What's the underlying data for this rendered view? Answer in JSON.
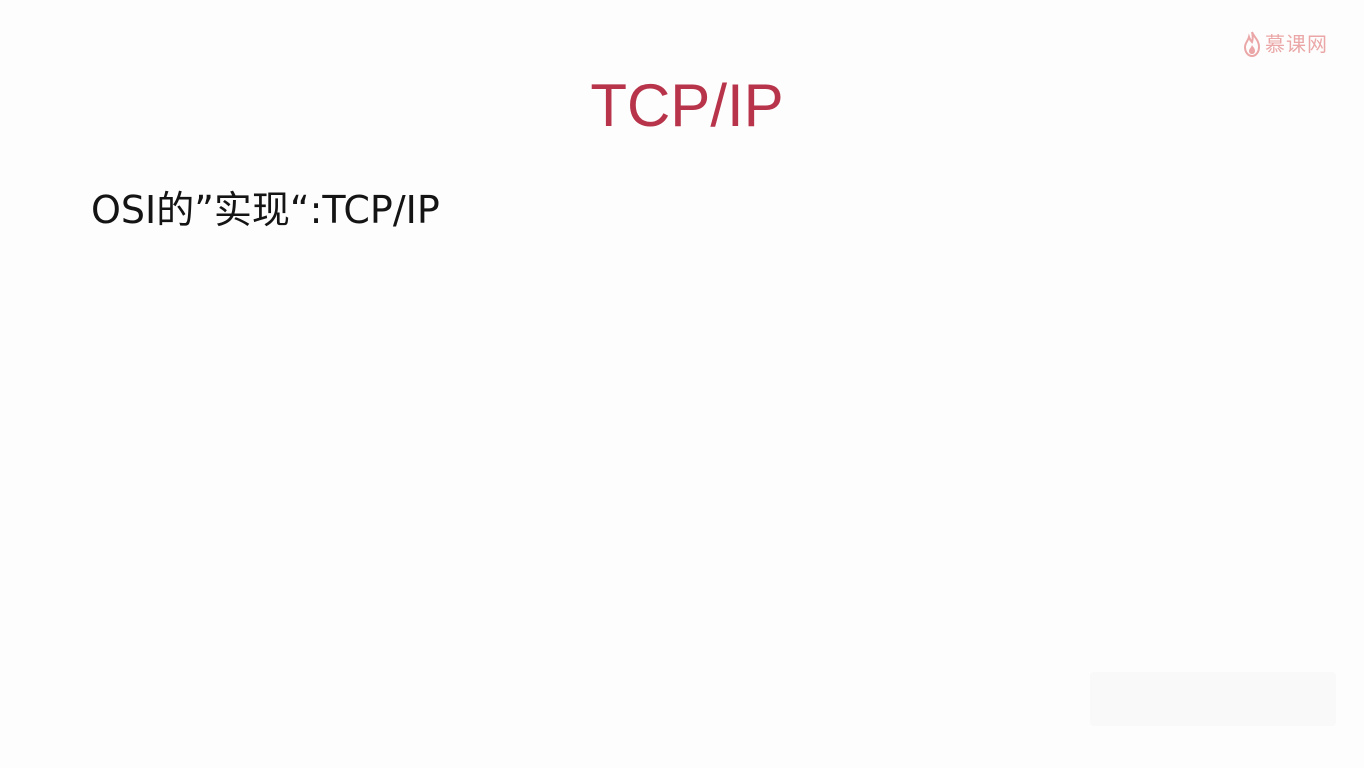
{
  "slide": {
    "title": "TCP/IP",
    "bullet": "OSI的”实现“:TCP/IP"
  },
  "logo": {
    "icon": "flame-icon",
    "text": "慕课网",
    "color": "#e58b8b"
  },
  "colors": {
    "title": "#b8344a",
    "body_text": "#141414",
    "background": "#fdfdfd"
  }
}
